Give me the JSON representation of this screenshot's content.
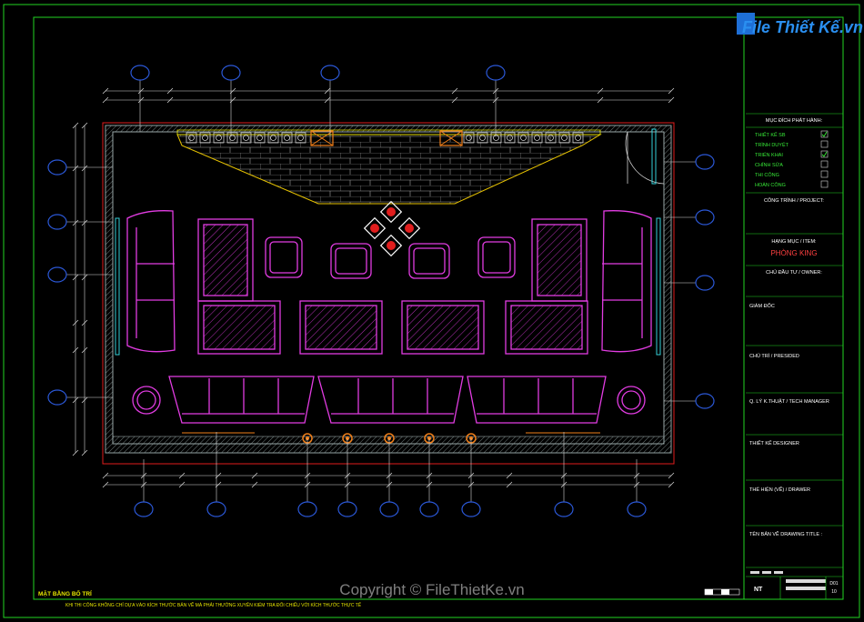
{
  "logo": {
    "text": "File Thiết Kế.vn"
  },
  "watermark": {
    "text": "Copyright © FileThietKe.vn"
  },
  "drawing": {
    "title": "MẶT BẰNG BỐ TRÍ",
    "note": "KHI THI CÔNG KHÔNG CHỈ DỰA VÀO KÍCH THƯỚC BẢN VẼ MÀ PHẢI THƯỜNG XUYÊN KIỂM TRA ĐỐI CHIẾU VỚI KÍCH THƯỚC THỰC TẾ"
  },
  "title_block": {
    "purpose_heading": "MỤC ĐÍCH PHÁT HÀNH:",
    "purposes": [
      {
        "label": "THIẾT KẾ SB",
        "checked": true
      },
      {
        "label": "TRÌNH DUYỆT",
        "checked": false
      },
      {
        "label": "TRIỂN KHAI",
        "checked": true
      },
      {
        "label": "CHỈNH SỬA",
        "checked": false
      },
      {
        "label": "THI CÔNG",
        "checked": false
      },
      {
        "label": "HOÀN CÔNG",
        "checked": false
      }
    ],
    "project_label": "CÔNG TRÌNH / PROJECT:",
    "item_label": "HẠNG MỤC / ITEM:",
    "item_value": "PHÒNG KING",
    "owner_label": "CHỦ ĐẦU TƯ / OWNER:",
    "director_label": "GIÁM ĐỐC",
    "presided_label": "CHỦ TRÌ / PRESIDED",
    "tech_label": "Q. LÝ K.THUẬT / TECH MANAGER",
    "designer_label": "THIẾT KẾ DESIGNER",
    "drawer_label": "THỂ HIỆN (VẼ) / DRAWER",
    "drawing_title_label": "TÊN BẢN VẼ DRAWING TITLE :",
    "sheet_code": "NT",
    "sheet_number": "D01",
    "sheet_count": "10"
  },
  "colors": {
    "frame": "#22d322",
    "magenta": "#e23ce2",
    "yellow": "#e6e600",
    "wall": "#8f9f9f",
    "red": "#e11d1d",
    "blue": "#2b58d8",
    "orange": "#f07f1a",
    "cyan": "#34d0d8",
    "white": "#f2f2f2"
  }
}
